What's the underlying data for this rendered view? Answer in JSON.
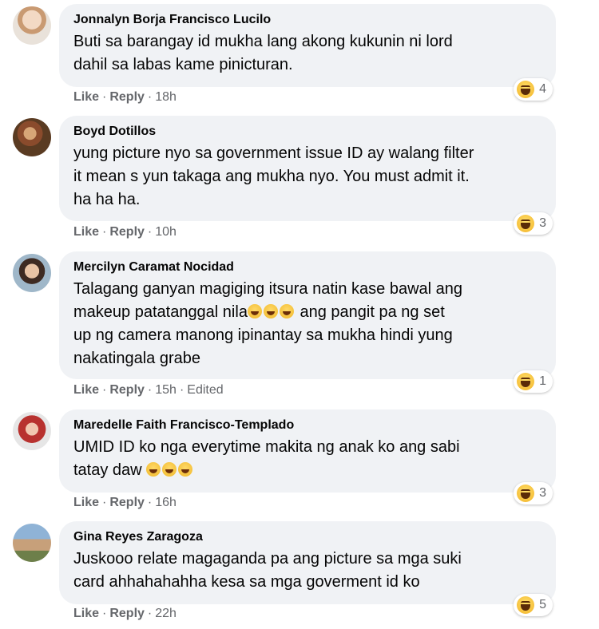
{
  "comments": [
    {
      "author": "Jonnalyn Borja Francisco Lucilo",
      "text": "Buti sa barangay id mukha lang akong kukunin ni lord\ndahil sa labas kame pinicturan.",
      "text_parts": [],
      "reaction_icon": "haha-icon",
      "reaction_count": "4",
      "like": "Like",
      "reply": "Reply",
      "time": "18h",
      "edited": ""
    },
    {
      "author": "Boyd Dotillos",
      "text": "yung picture nyo sa government issue ID ay walang filter\nit mean s yun takaga ang mukha nyo. You must admit it.\nha ha ha.",
      "reaction_icon": "haha-icon",
      "reaction_count": "3",
      "like": "Like",
      "reply": "Reply",
      "time": "10h",
      "edited": ""
    },
    {
      "author": "Mercilyn Caramat Nocidad",
      "text_a": "Talagang ganyan magiging itsura natin kase bawal ang\nmakeup patatanggal nila",
      "text_b": " ang pangit pa ng set\nup ng camera manong ipinantay sa mukha hindi yung\nnakatingala grabe",
      "emoji_count": 3,
      "reaction_icon": "haha-icon",
      "reaction_count": "1",
      "like": "Like",
      "reply": "Reply",
      "time": "15h",
      "edited": "Edited"
    },
    {
      "author": "Maredelle Faith Francisco-Templado",
      "text_a": "UMID ID ko nga everytime makita ng anak ko ang sabi\ntatay daw ",
      "emoji_count": 3,
      "reaction_icon": "haha-icon",
      "reaction_count": "3",
      "like": "Like",
      "reply": "Reply",
      "time": "16h",
      "edited": ""
    },
    {
      "author": "Gina Reyes Zaragoza",
      "text": "Juskooo relate magaganda pa ang picture sa mga suki\ncard ahhahahahha kesa sa mga goverment id ko",
      "reaction_icon": "haha-icon",
      "reaction_count": "5",
      "like": "Like",
      "reply": "Reply",
      "time": "22h",
      "edited": ""
    }
  ],
  "separator": "·"
}
